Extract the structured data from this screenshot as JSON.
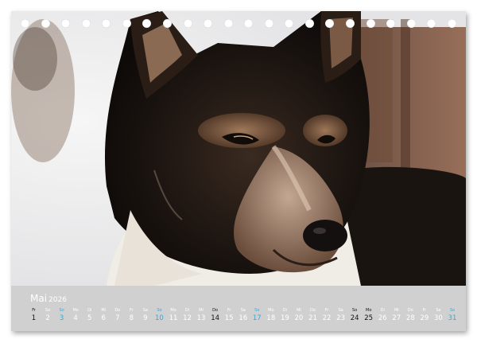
{
  "calendar": {
    "month": "Mai",
    "year": "2026",
    "photo_subject": "husky-dog",
    "colors": {
      "footer_bg": "#d0d0d0",
      "sunday": "#3aa6d6",
      "holiday": "#111111",
      "weekday": "#ffffff"
    },
    "days": [
      {
        "dow": "Fr",
        "num": "1",
        "type": "holiday"
      },
      {
        "dow": "Sa",
        "num": "2",
        "type": "normal"
      },
      {
        "dow": "So",
        "num": "3",
        "type": "sun"
      },
      {
        "dow": "Mo",
        "num": "4",
        "type": "normal"
      },
      {
        "dow": "Di",
        "num": "5",
        "type": "normal"
      },
      {
        "dow": "Mi",
        "num": "6",
        "type": "normal"
      },
      {
        "dow": "Do",
        "num": "7",
        "type": "normal"
      },
      {
        "dow": "Fr",
        "num": "8",
        "type": "normal"
      },
      {
        "dow": "Sa",
        "num": "9",
        "type": "normal"
      },
      {
        "dow": "So",
        "num": "10",
        "type": "sun"
      },
      {
        "dow": "Mo",
        "num": "11",
        "type": "normal"
      },
      {
        "dow": "Di",
        "num": "12",
        "type": "normal"
      },
      {
        "dow": "Mi",
        "num": "13",
        "type": "normal"
      },
      {
        "dow": "Do",
        "num": "14",
        "type": "holiday"
      },
      {
        "dow": "Fr",
        "num": "15",
        "type": "normal"
      },
      {
        "dow": "Sa",
        "num": "16",
        "type": "normal"
      },
      {
        "dow": "So",
        "num": "17",
        "type": "sun"
      },
      {
        "dow": "Mo",
        "num": "18",
        "type": "normal"
      },
      {
        "dow": "Di",
        "num": "19",
        "type": "normal"
      },
      {
        "dow": "Mi",
        "num": "20",
        "type": "normal"
      },
      {
        "dow": "Do",
        "num": "21",
        "type": "normal"
      },
      {
        "dow": "Fr",
        "num": "22",
        "type": "normal"
      },
      {
        "dow": "Sa",
        "num": "23",
        "type": "normal"
      },
      {
        "dow": "So",
        "num": "24",
        "type": "holiday"
      },
      {
        "dow": "Mo",
        "num": "25",
        "type": "holiday"
      },
      {
        "dow": "Di",
        "num": "26",
        "type": "normal"
      },
      {
        "dow": "Mi",
        "num": "27",
        "type": "normal"
      },
      {
        "dow": "Do",
        "num": "28",
        "type": "normal"
      },
      {
        "dow": "Fr",
        "num": "29",
        "type": "normal"
      },
      {
        "dow": "Sa",
        "num": "30",
        "type": "normal"
      },
      {
        "dow": "So",
        "num": "31",
        "type": "sun"
      }
    ]
  }
}
